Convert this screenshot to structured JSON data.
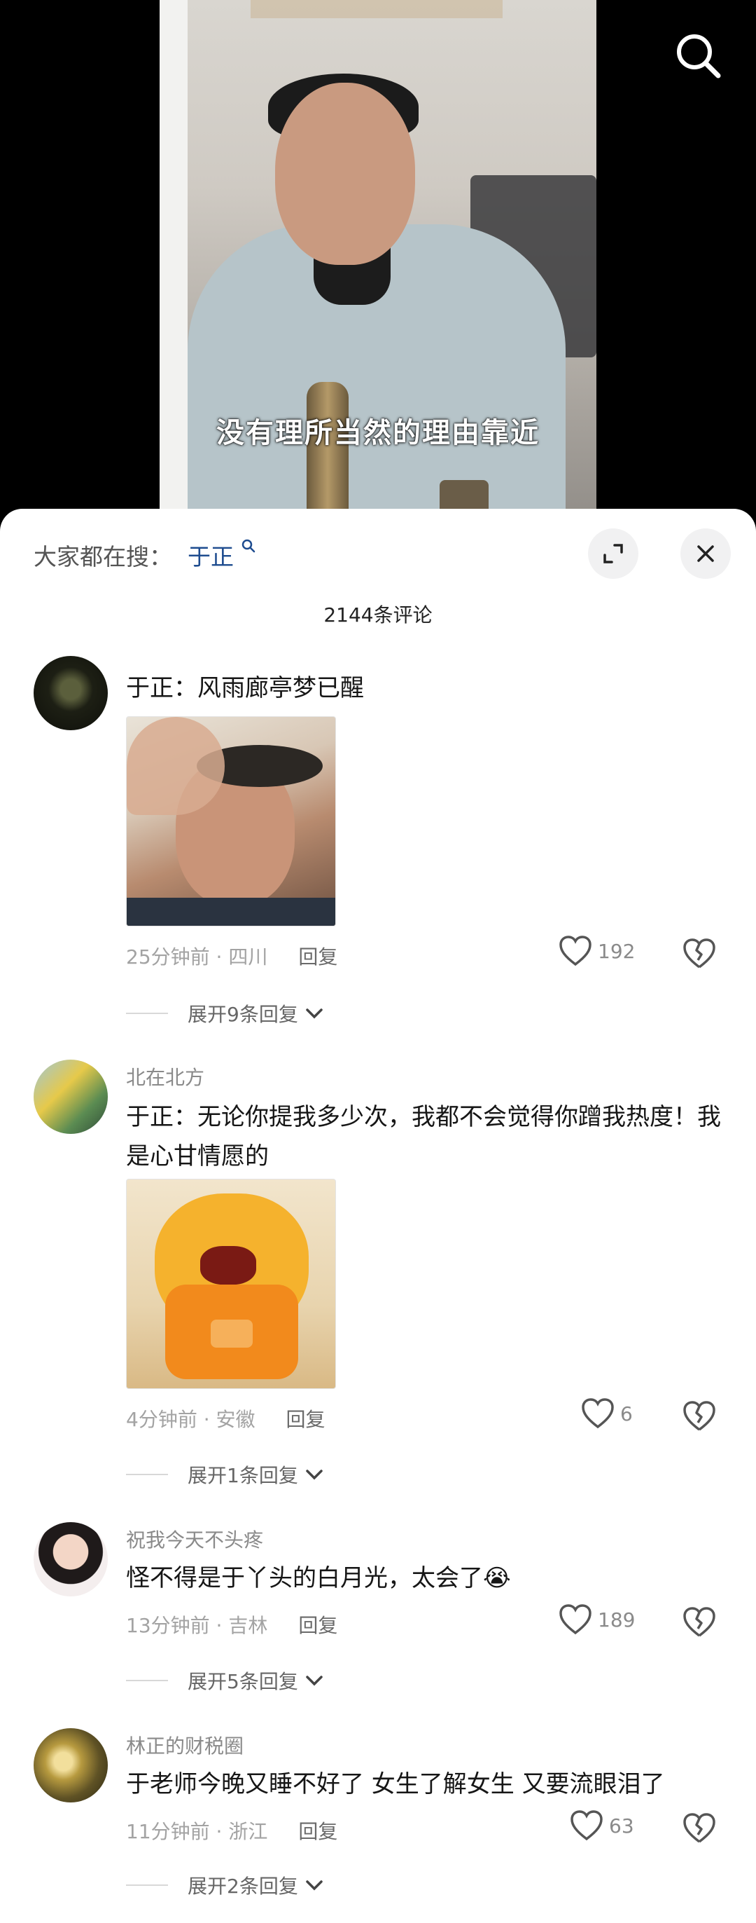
{
  "video": {
    "subtitle": "没有理所当然的理由靠近",
    "search_icon": "search-icon"
  },
  "panel": {
    "hot_search_label": "大家都在搜：",
    "hot_search_term": "于正",
    "comment_count": "2144条评论"
  },
  "comments": [
    {
      "username": "",
      "text": "于正：风雨廊亭梦已醒",
      "time_location": "25分钟前 · 四川",
      "reply_label": "回复",
      "likes": "192",
      "expand": "展开9条回复"
    },
    {
      "username": "北在北方",
      "text": "于正：无论你提我多少次，我都不会觉得你蹭我热度！我是心甘情愿的",
      "time_location": "4分钟前 · 安徽",
      "reply_label": "回复",
      "likes": "6",
      "expand": "展开1条回复"
    },
    {
      "username": "祝我今天不头疼",
      "text": "怪不得是于丫头的白月光，太会了😭",
      "time_location": "13分钟前 · 吉林",
      "reply_label": "回复",
      "likes": "189",
      "expand": "展开5条回复"
    },
    {
      "username": "林正的财税圈",
      "text": "于老师今晚又睡不好了 女生了解女生 又要流眼泪了",
      "time_location": "11分钟前 · 浙江",
      "reply_label": "回复",
      "likes": "63",
      "expand": "展开2条回复"
    }
  ]
}
